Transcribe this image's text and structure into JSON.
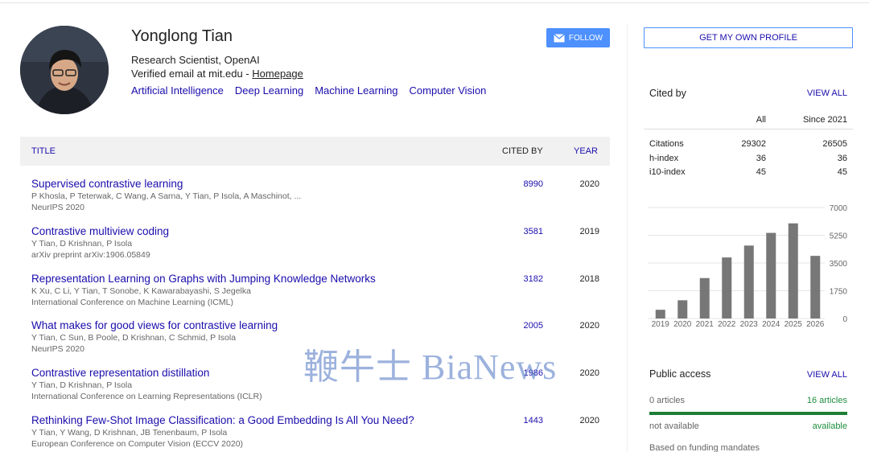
{
  "profile": {
    "name": "Yonglong Tian",
    "affiliation": "Research Scientist, OpenAI",
    "verified_prefix": "Verified email at mit.edu - ",
    "homepage_label": "Homepage",
    "interests": [
      "Artificial Intelligence",
      "Deep Learning",
      "Machine Learning",
      "Computer Vision"
    ],
    "follow_label": "FOLLOW"
  },
  "table": {
    "col_title": "TITLE",
    "col_cited": "CITED BY",
    "col_year": "YEAR",
    "rows": [
      {
        "title": "Supervised contrastive learning",
        "authors": "P Khosla, P Teterwak, C Wang, A Sarna, Y Tian, P Isola, A Maschinot, ...",
        "venue": "NeurIPS 2020",
        "cited": "8990",
        "year": "2020"
      },
      {
        "title": "Contrastive multiview coding",
        "authors": "Y Tian, D Krishnan, P Isola",
        "venue": "arXiv preprint arXiv:1906.05849",
        "cited": "3581",
        "year": "2019"
      },
      {
        "title": "Representation Learning on Graphs with Jumping Knowledge Networks",
        "authors": "K Xu, C Li, Y Tian, T Sonobe, K Kawarabayashi, S Jegelka",
        "venue": "International Conference on Machine Learning (ICML)",
        "cited": "3182",
        "year": "2018"
      },
      {
        "title": "What makes for good views for contrastive learning",
        "authors": "Y Tian, C Sun, B Poole, D Krishnan, C Schmid, P Isola",
        "venue": "NeurIPS 2020",
        "cited": "2005",
        "year": "2020"
      },
      {
        "title": "Contrastive representation distillation",
        "authors": "Y Tian, D Krishnan, P Isola",
        "venue": "International Conference on Learning Representations (ICLR)",
        "cited": "1986",
        "year": "2020"
      },
      {
        "title": "Rethinking Few-Shot Image Classification: a Good Embedding Is All You Need?",
        "authors": "Y Tian, Y Wang, D Krishnan, JB Tenenbaum, P Isola",
        "venue": "European Conference on Computer Vision (ECCV 2020)",
        "cited": "1443",
        "year": "2020"
      }
    ]
  },
  "watermark": "鞭牛士 BiaNews",
  "sidebar": {
    "own_profile_label": "GET MY OWN PROFILE",
    "cited_by_title": "Cited by",
    "view_all": "VIEW ALL",
    "col_all": "All",
    "col_since": "Since 2021",
    "metrics": [
      {
        "label": "Citations",
        "all": "29302",
        "since": "26505"
      },
      {
        "label": "h-index",
        "all": "36",
        "since": "36"
      },
      {
        "label": "i10-index",
        "all": "45",
        "since": "45"
      }
    ],
    "public_access_title": "Public access",
    "public_access_view_all": "VIEW ALL",
    "articles_left": "0 articles",
    "articles_right": "16 articles",
    "status_left": "not available",
    "status_right": "available",
    "footer": "Based on funding mandates"
  },
  "chart_data": {
    "type": "bar",
    "categories": [
      "2019",
      "2020",
      "2021",
      "2022",
      "2023",
      "2024",
      "2025",
      "2026"
    ],
    "values": [
      550,
      1150,
      2550,
      3850,
      4600,
      5400,
      6000,
      3950
    ],
    "ylim": [
      0,
      7000
    ],
    "yticks": [
      "7000",
      "5250",
      "3500",
      "1750",
      "0"
    ],
    "grid": true,
    "bar_color": "#777777"
  },
  "colors": {
    "link": "#1a0dab",
    "button": "#4d90fe",
    "green": "#1e8e3e"
  }
}
